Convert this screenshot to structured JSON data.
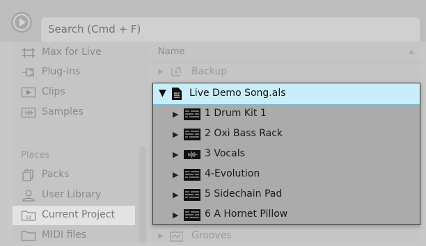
{
  "search": {
    "placeholder": "Search (Cmd + F)"
  },
  "sidebar": {
    "categories": [
      {
        "label": "Max for Live",
        "icon": "max-for-live-icon"
      },
      {
        "label": "Plug-ins",
        "icon": "plug-in-icon"
      },
      {
        "label": "Clips",
        "icon": "clip-icon"
      },
      {
        "label": "Samples",
        "icon": "sample-icon"
      }
    ],
    "places_title": "Places",
    "places": [
      {
        "label": "Packs",
        "icon": "packs-icon"
      },
      {
        "label": "User Library",
        "icon": "user-icon"
      },
      {
        "label": "Current Project",
        "icon": "project-folder-icon",
        "selected": true
      },
      {
        "label": "MIDI files",
        "icon": "folder-icon"
      }
    ]
  },
  "content": {
    "column_header": "Name",
    "rows": [
      {
        "label": "Backup",
        "icon": "backup-icon"
      },
      {
        "label": "Grooves",
        "icon": "groove-icon"
      }
    ]
  },
  "popup": {
    "file": "Live Demo Song.als",
    "tracks": [
      {
        "label": "1 Drum Kit 1",
        "icon": "rack-icon"
      },
      {
        "label": "2 Oxi Bass Rack",
        "icon": "rack-icon"
      },
      {
        "label": "3 Vocals",
        "icon": "audio-track-icon"
      },
      {
        "label": "4-Evolution",
        "icon": "rack-icon"
      },
      {
        "label": "5 Sidechain Pad",
        "icon": "rack-icon"
      },
      {
        "label": "6 A Hornet Pillow",
        "icon": "rack-icon"
      }
    ]
  },
  "colors": {
    "selection": "#c9eefa",
    "popup_bg": "#ababab",
    "panel_bg": "#c5c5c5"
  }
}
